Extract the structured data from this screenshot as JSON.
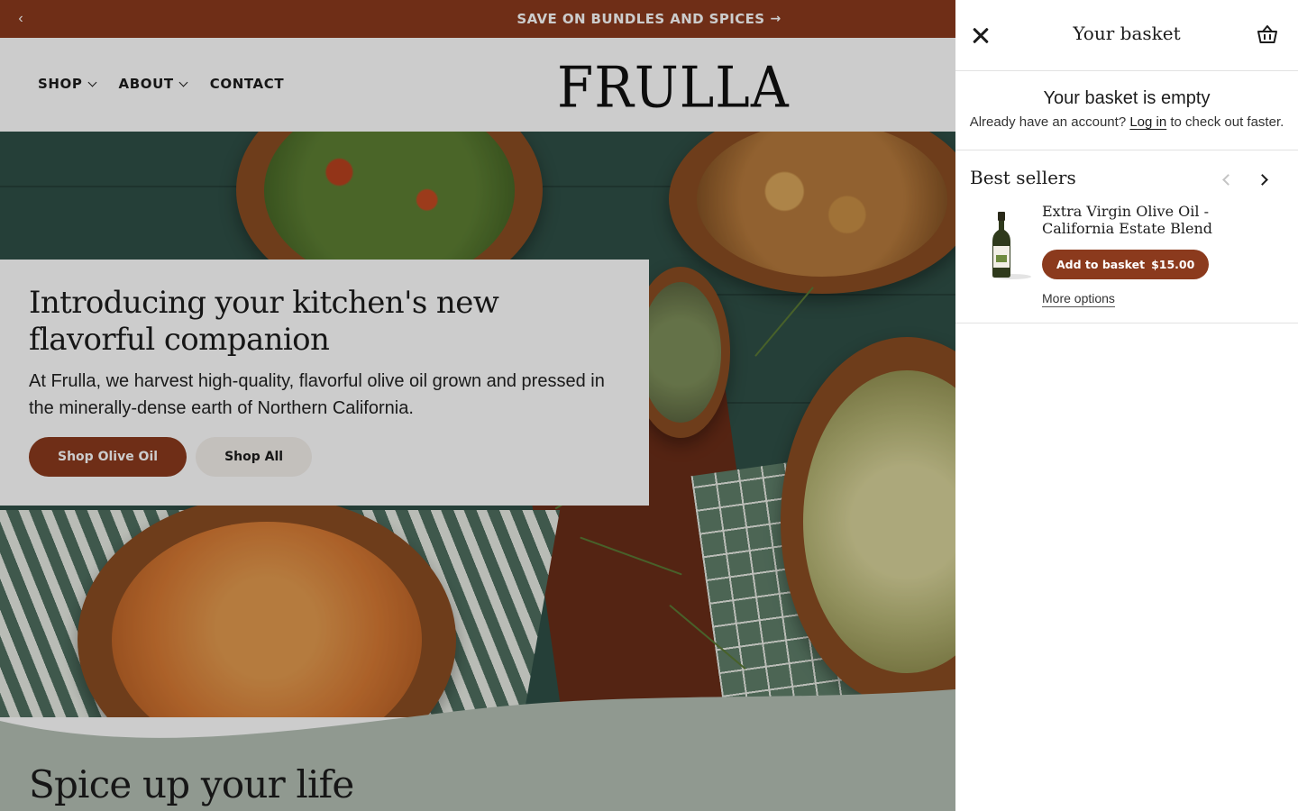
{
  "announcement": {
    "prev_icon": "chevron-left-icon",
    "text": "SAVE ON BUNDLES AND SPICES",
    "arrow": "→"
  },
  "nav": {
    "items": [
      {
        "label": "SHOP",
        "has_dropdown": true
      },
      {
        "label": "ABOUT",
        "has_dropdown": true
      },
      {
        "label": "CONTACT",
        "has_dropdown": false
      }
    ]
  },
  "logo": {
    "text": "FRULLA"
  },
  "hero": {
    "title": "Introducing your kitchen's new flavorful companion",
    "text": "At Frulla, we harvest high-quality, flavorful olive oil grown and pressed in the minerally-dense earth of Northern California.",
    "primary_button": "Shop Olive Oil",
    "secondary_button": "Shop All"
  },
  "next_section": {
    "title": "Spice up your life"
  },
  "drawer": {
    "title": "Your basket",
    "empty_title": "Your basket is empty",
    "account_prefix": "Already have an account?",
    "login_link": "Log in",
    "account_suffix": "to check out faster.",
    "best_sellers": {
      "title": "Best sellers",
      "product": {
        "name": "Extra Virgin Olive Oil - California Estate Blend",
        "add_label": "Add to basket",
        "price": "$15.00",
        "more_options": "More options"
      }
    }
  },
  "colors": {
    "brand": "#8b3a1d",
    "hero_background": "#2f4f46",
    "section_background": "#b4c0b5"
  }
}
